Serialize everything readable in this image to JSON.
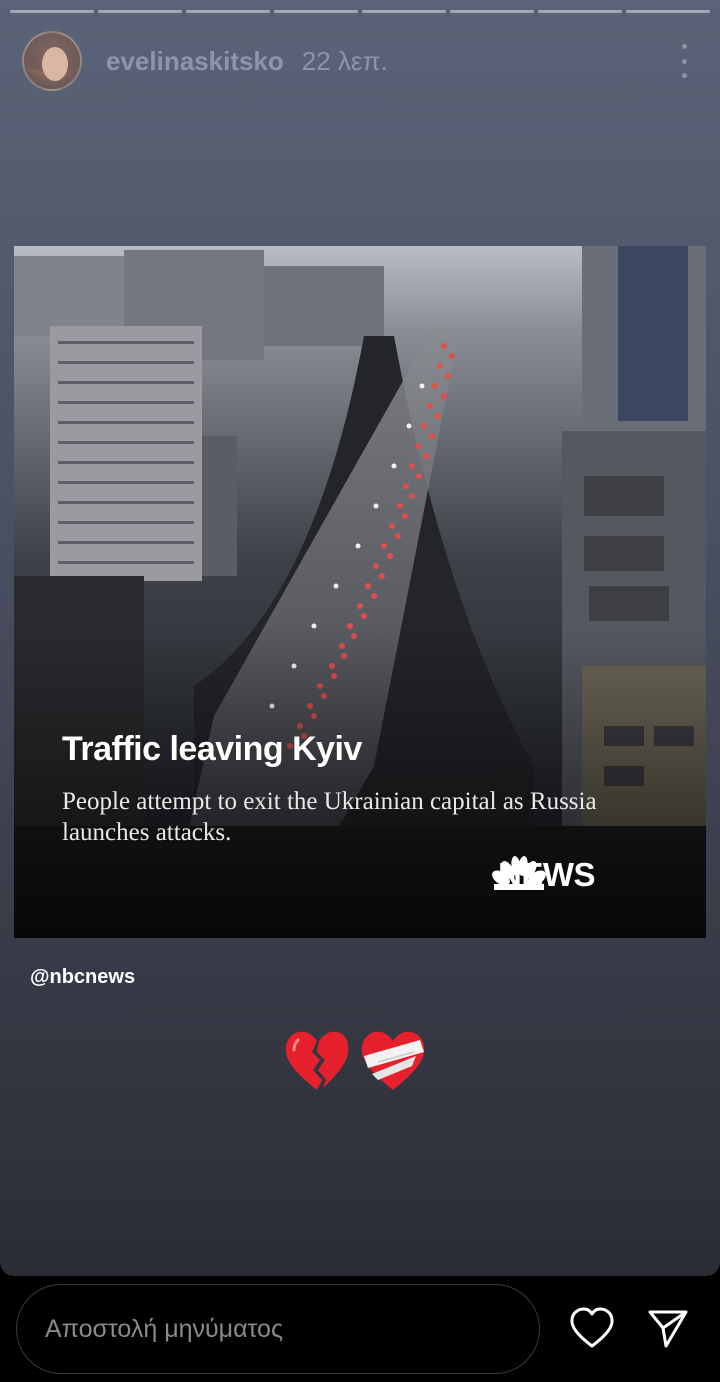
{
  "story": {
    "progress_segments": 8,
    "progress_completed": 0,
    "user": {
      "username": "evelinaskitsko",
      "time_ago": "22 λεπ."
    },
    "icons": {
      "more": "more-vertical-icon"
    }
  },
  "shared_post": {
    "title": "Traffic leaving Kyiv",
    "subtitle": "People attempt to exit the Ukrainian capital as Russia launches attacks.",
    "brand": "NEWS",
    "brand_logo": "nbc-peacock-logo"
  },
  "mention": "@nbcnews",
  "stickers": [
    "broken-heart-emoji",
    "mending-heart-emoji"
  ],
  "footer": {
    "message_placeholder": "Αποστολή μηνύματος",
    "like_icon": "heart-outline-icon",
    "send_icon": "paper-plane-icon"
  },
  "colors": {
    "story_bg_top": "#5b6378",
    "story_bg_bottom": "#2b2d35",
    "text_muted": "#8d95a8",
    "brake_lights": "#e0504a"
  }
}
